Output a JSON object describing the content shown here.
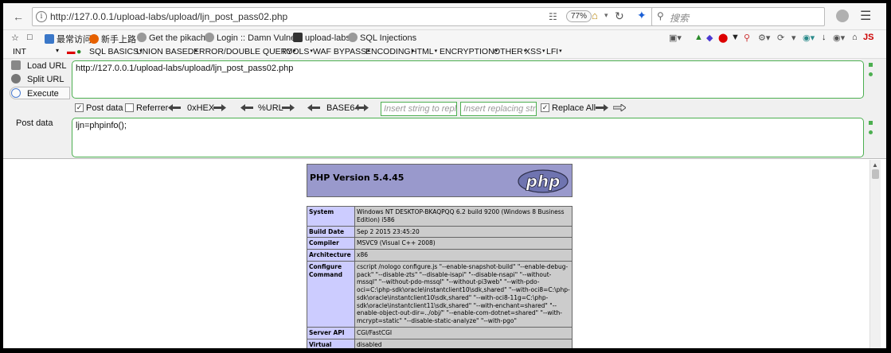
{
  "browser": {
    "url": "http://127.0.0.1/upload-labs/upload/ljn_post_pass02.php",
    "zoom": "77%",
    "search_placeholder": "搜索"
  },
  "bookmarks": [
    {
      "label": "最常访问",
      "icon": "blue-square"
    },
    {
      "label": "新手上路",
      "icon": "firefox"
    },
    {
      "label": "Get the pikachu",
      "icon": "globe"
    },
    {
      "label": "Login :: Damn Vulne...",
      "icon": "globe"
    },
    {
      "label": "upload-labs",
      "icon": "folder"
    },
    {
      "label": "SQL Injections",
      "icon": "globe"
    }
  ],
  "hackbar_menu": {
    "int_label": "INT",
    "items": [
      "SQL BASICS",
      "UNION BASED",
      "ERROR/DOUBLE QUERY",
      "TOOLS",
      "WAF BYPASS",
      "ENCODING",
      "HTML",
      "ENCRYPTION",
      "OTHER",
      "XSS",
      "LFI"
    ]
  },
  "hackbar": {
    "load_url": "Load URL",
    "split_url": "Split URL",
    "execute": "Execute",
    "url_value": "http://127.0.0.1/upload-labs/upload/ljn_post_pass02.php",
    "post_data_check": "Post data",
    "referrer_check": "Referrer",
    "hex": "0xHEX",
    "url_enc": "%URL",
    "base64": "BASE64",
    "replace_placeholder": "Insert string to replace",
    "replacing_placeholder": "Insert replacing string",
    "replace_all": "Replace All",
    "post_label": "Post data",
    "post_value": "ljn=phpinfo();"
  },
  "php": {
    "version_title": "PHP Version 5.4.45",
    "logo_text": "php",
    "rows": [
      {
        "key": "System",
        "value": "Windows NT DESKTOP-BKAQPQQ 6.2 build 9200 (Windows 8 Business Edition) i586"
      },
      {
        "key": "Build Date",
        "value": "Sep 2 2015 23:45:20"
      },
      {
        "key": "Compiler",
        "value": "MSVC9 (Visual C++ 2008)"
      },
      {
        "key": "Architecture",
        "value": "x86"
      },
      {
        "key": "Configure Command",
        "value": "cscript /nologo configure.js \"--enable-snapshot-build\" \"--enable-debug-pack\" \"--disable-zts\" \"--disable-isapi\" \"--disable-nsapi\" \"--without-mssql\" \"--without-pdo-mssql\" \"--without-pi3web\" \"--with-pdo-oci=C:\\php-sdk\\oracle\\instantclient10\\sdk,shared\" \"--with-oci8=C:\\php-sdk\\oracle\\instantclient10\\sdk,shared\" \"--with-oci8-11g=C:\\php-sdk\\oracle\\instantclient11\\sdk,shared\" \"--with-enchant=shared\" \"--enable-object-out-dir=../obj/\" \"--enable-com-dotnet=shared\" \"--with-mcrypt=static\" \"--disable-static-analyze\" \"--with-pgo\""
      },
      {
        "key": "Server API",
        "value": "CGI/FastCGI"
      },
      {
        "key": "Virtual Directory Support",
        "value": "disabled"
      }
    ]
  },
  "colors": {
    "hackbar_green": "#4caf50",
    "php_header": "#9999cc",
    "php_key": "#ccccff",
    "php_value": "#cccccc"
  }
}
